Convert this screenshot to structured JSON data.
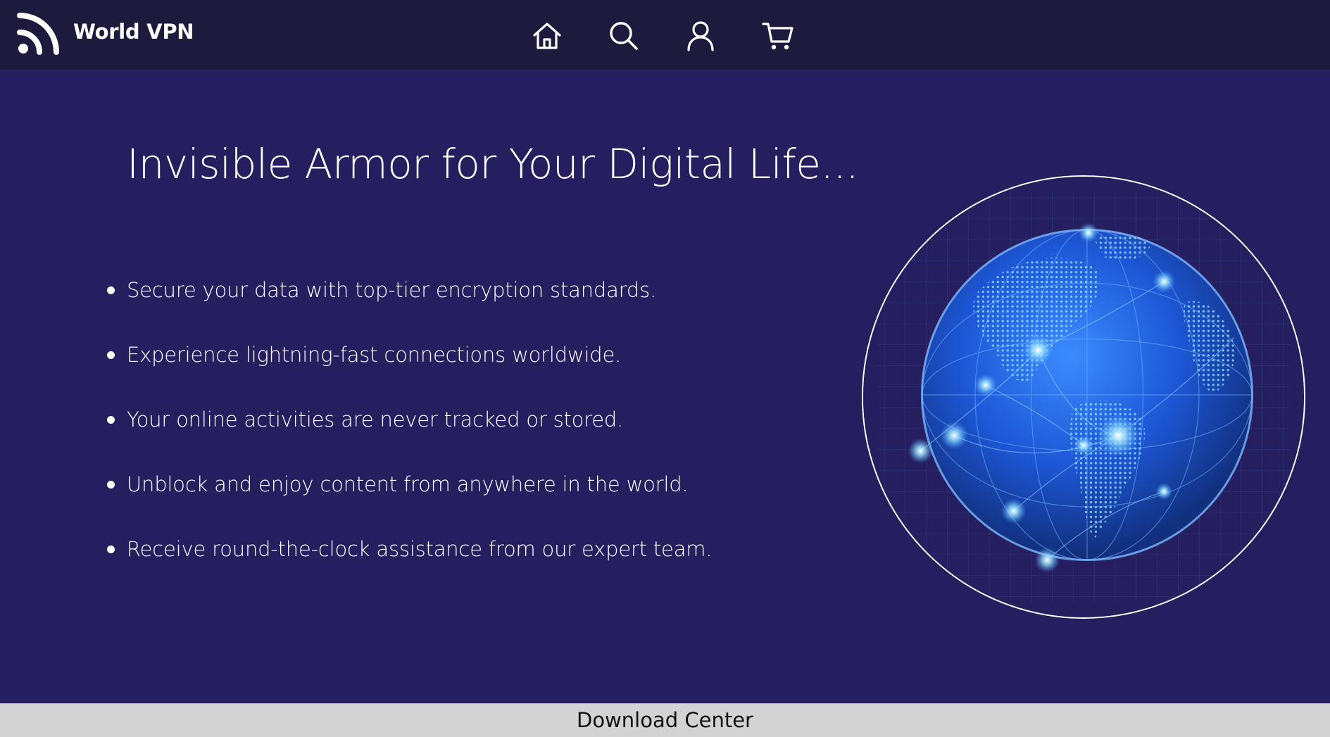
{
  "brand": {
    "name": "World VPN",
    "logo_icon": "wifi-signal-icon"
  },
  "nav": {
    "items": [
      {
        "name": "home",
        "icon": "home-icon"
      },
      {
        "name": "search",
        "icon": "search-icon"
      },
      {
        "name": "account",
        "icon": "user-icon"
      },
      {
        "name": "cart",
        "icon": "cart-icon"
      }
    ]
  },
  "hero": {
    "headline": "Invisible Armor for Your Digital Life...",
    "features": [
      "Secure your data with top-tier encryption standards.",
      "Experience lightning-fast connections worldwide.",
      "Your online activities are never tracked or stored.",
      "Unblock and enjoy content from anywhere in the world.",
      "Receive round-the-clock assistance from our expert team."
    ],
    "image": "globe-network-illustration"
  },
  "footer": {
    "label": "Download Center"
  },
  "colors": {
    "header_bg": "#1c1b3d",
    "page_bg": "#251f60",
    "footer_bg": "#d3d3d3",
    "text": "#ffffff",
    "globe_accent": "#4aa8ff"
  }
}
